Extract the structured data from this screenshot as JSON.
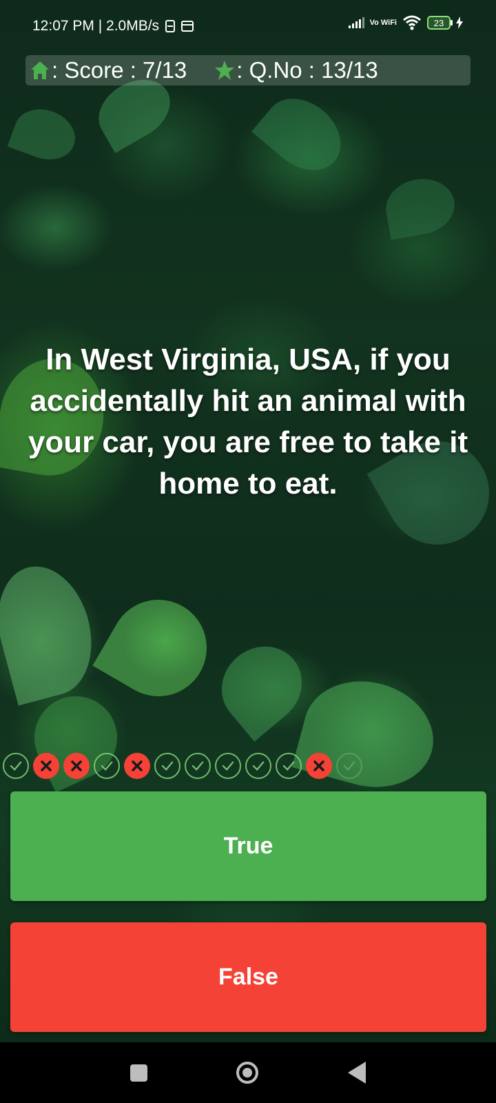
{
  "status_bar": {
    "time_speed": "12:07 PM | 2.0MB/s",
    "network_label": "Vo WiFi",
    "battery": "23"
  },
  "score_bar": {
    "score_text": ": Score : 7/13",
    "question_number_text": ": Q.No : 13/13",
    "home_icon": "home-icon",
    "star_icon": "star-icon",
    "icon_color": "#4caf50"
  },
  "question": {
    "text": "In West Virginia, USA, if you accidentally hit an animal with your car, you are free to take it home to eat."
  },
  "progress": {
    "results": [
      "correct",
      "wrong",
      "wrong",
      "correct",
      "wrong",
      "correct",
      "correct",
      "correct",
      "correct",
      "correct",
      "wrong",
      "pending"
    ]
  },
  "answers": {
    "true_label": "True",
    "false_label": "False",
    "true_color": "#4caf50",
    "false_color": "#f44336"
  },
  "nav_bar": {
    "recents_icon": "square-icon",
    "home_icon": "circle-home-icon",
    "back_icon": "back-triangle-icon"
  }
}
